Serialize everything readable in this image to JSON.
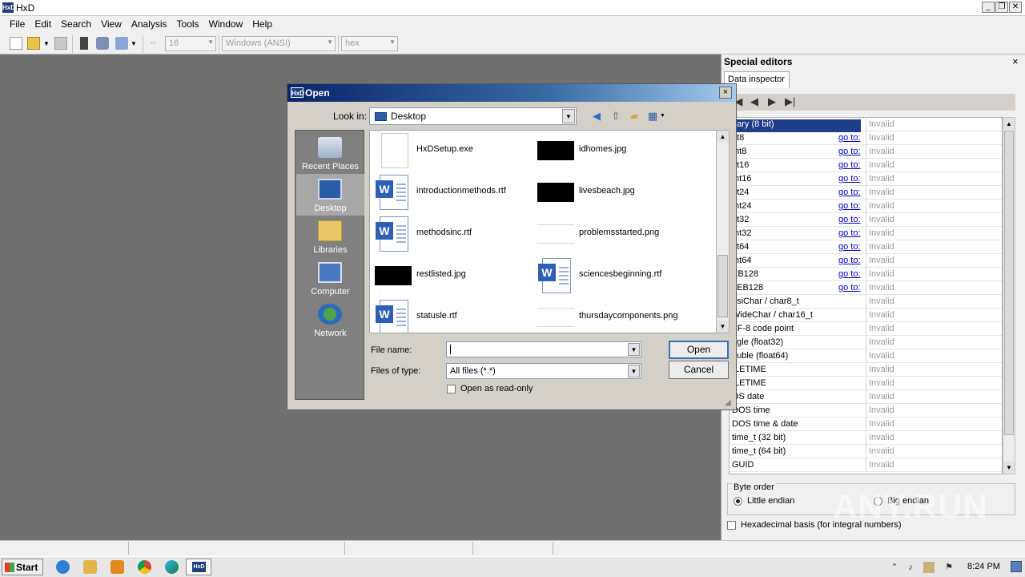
{
  "window": {
    "title": "HxD",
    "app_icon_text": "HxD"
  },
  "menubar": {
    "items": [
      "File",
      "Edit",
      "Search",
      "View",
      "Analysis",
      "Tools",
      "Window",
      "Help"
    ]
  },
  "toolbar": {
    "bytes_per_row": "16",
    "charset": "Windows (ANSI)",
    "offset_base": "hex",
    "icons": [
      "new-file-icon",
      "open-file-icon",
      "save-icon",
      "close-icon",
      "ram-icon",
      "disk-icon"
    ]
  },
  "special_editors": {
    "title": "Special editors",
    "close_glyph": "×",
    "tab": "Data inspector",
    "rows": [
      {
        "name": "nary (8 bit)",
        "goto": "",
        "value": "Invalid",
        "selected": true
      },
      {
        "name": "nt8",
        "goto": "go to:",
        "value": "Invalid"
      },
      {
        "name": "Int8",
        "goto": "go to:",
        "value": "Invalid"
      },
      {
        "name": "nt16",
        "goto": "go to:",
        "value": "Invalid"
      },
      {
        "name": "Int16",
        "goto": "go to:",
        "value": "Invalid"
      },
      {
        "name": "nt24",
        "goto": "go to:",
        "value": "Invalid"
      },
      {
        "name": "Int24",
        "goto": "go to:",
        "value": "Invalid"
      },
      {
        "name": "nt32",
        "goto": "go to:",
        "value": "Invalid"
      },
      {
        "name": "Int32",
        "goto": "go to:",
        "value": "Invalid"
      },
      {
        "name": "nt64",
        "goto": "go to:",
        "value": "Invalid"
      },
      {
        "name": "Int64",
        "goto": "go to:",
        "value": "Invalid"
      },
      {
        "name": "EB128",
        "goto": "go to:",
        "value": "Invalid"
      },
      {
        "name": "LEB128",
        "goto": "go to:",
        "value": "Invalid"
      },
      {
        "name": "nsiChar / char8_t",
        "goto": "",
        "value": "Invalid"
      },
      {
        "name": "WideChar / char16_t",
        "goto": "",
        "value": "Invalid"
      },
      {
        "name": "TF-8 code point",
        "goto": "",
        "value": "Invalid"
      },
      {
        "name": "ngle (float32)",
        "goto": "",
        "value": "Invalid"
      },
      {
        "name": "ouble (float64)",
        "goto": "",
        "value": "Invalid"
      },
      {
        "name": "ILETIME",
        "goto": "",
        "value": "Invalid"
      },
      {
        "name": "ILETIME",
        "goto": "",
        "value": "Invalid"
      },
      {
        "name": "OS date",
        "goto": "",
        "value": "Invalid"
      },
      {
        "name": "DOS time",
        "goto": "",
        "value": "Invalid"
      },
      {
        "name": "DOS time & date",
        "goto": "",
        "value": "Invalid"
      },
      {
        "name": "time_t (32 bit)",
        "goto": "",
        "value": "Invalid"
      },
      {
        "name": "time_t (64 bit)",
        "goto": "",
        "value": "Invalid"
      },
      {
        "name": "GUID",
        "goto": "",
        "value": "Invalid"
      }
    ],
    "byte_order": {
      "label": "Byte order",
      "little_endian": "Little endian",
      "big_endian": "Big endian",
      "selected": "Little endian"
    },
    "hex_basis_label": "Hexadecimal basis (for integral numbers)",
    "hex_basis_checked": false
  },
  "dialog": {
    "title": "Open",
    "close_glyph": "×",
    "look_in_label": "Look in:",
    "look_in_value": "Desktop",
    "places": [
      {
        "label": "Recent Places",
        "icon": "recent-places-icon"
      },
      {
        "label": "Desktop",
        "icon": "desktop-icon",
        "active": true
      },
      {
        "label": "Libraries",
        "icon": "libraries-icon"
      },
      {
        "label": "Computer",
        "icon": "computer-icon"
      },
      {
        "label": "Network",
        "icon": "network-icon"
      }
    ],
    "files": [
      {
        "name": "HxDSetup.exe",
        "kind": "blank"
      },
      {
        "name": "idhomes.jpg",
        "kind": "black"
      },
      {
        "name": "introductionmethods.rtf",
        "kind": "rtf"
      },
      {
        "name": "livesbeach.jpg",
        "kind": "black"
      },
      {
        "name": "methodsinc.rtf",
        "kind": "rtf"
      },
      {
        "name": "problemsstarted.png",
        "kind": "png"
      },
      {
        "name": "restlisted.jpg",
        "kind": "black"
      },
      {
        "name": "sciencesbeginning.rtf",
        "kind": "rtf"
      },
      {
        "name": "statusle.rtf",
        "kind": "rtf"
      },
      {
        "name": "thursdaycomponents.png",
        "kind": "png"
      }
    ],
    "file_name_label": "File name:",
    "file_name_value": "",
    "files_of_type_label": "Files of type:",
    "files_of_type_value": "All files (*.*)",
    "read_only_label": "Open as read-only",
    "read_only_checked": false,
    "open_button": "Open",
    "cancel_button": "Cancel"
  },
  "taskbar": {
    "start_label": "Start",
    "clock": "8:24 PM",
    "task_icons": [
      "ie-icon",
      "explorer-icon",
      "media-player-icon",
      "chrome-icon",
      "edge-icon",
      "hxd-task-icon"
    ]
  },
  "watermark": "ANY.RUN",
  "colors": {
    "selection": "#1e3e8a",
    "link": "#0000cc",
    "dialog_title_start": "#0a246a",
    "dialog_title_end": "#a6caf0"
  }
}
